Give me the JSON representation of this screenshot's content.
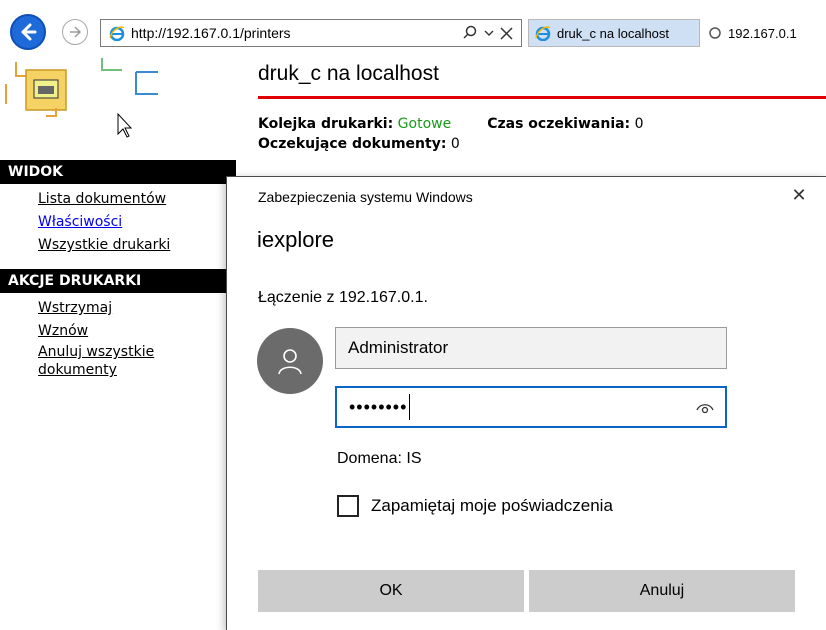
{
  "browser": {
    "url": "http://192.167.0.1/printers",
    "tabs": [
      {
        "label": "druk_c na localhost",
        "active": true
      },
      {
        "label": "192.167.0.1",
        "active": false
      }
    ]
  },
  "page": {
    "title": "druk_c na localhost",
    "queue_label": "Kolejka drukarki:",
    "queue_value": "Gotowe",
    "wait_label": "Czas oczekiwania:",
    "wait_value": "0",
    "pending_label": "Oczekujące dokumenty:",
    "pending_value": "0"
  },
  "sidebar": {
    "view_header": "WIDOK",
    "view_items": [
      {
        "label": "Lista dokumentów",
        "visited": false
      },
      {
        "label": "Właściwości",
        "visited": true
      },
      {
        "label": "Wszystkie drukarki",
        "visited": false
      }
    ],
    "actions_header": "AKCJE DRUKARKI",
    "action_items": [
      {
        "label": "Wstrzymaj"
      },
      {
        "label": "Wznów"
      },
      {
        "label": "Anuluj wszystkie dokumenty"
      }
    ]
  },
  "dialog": {
    "caption": "Zabezpieczenia systemu Windows",
    "close_glyph": "✕",
    "app_name": "iexplore",
    "connecting_text": "Łączenie z 192.167.0.1.",
    "username": "Administrator",
    "password_mask": "••••••••",
    "domain_text": "Domena: IS",
    "remember_label": "Zapamiętaj moje poświadczenia",
    "ok_label": "OK",
    "cancel_label": "Anuluj"
  },
  "colors": {
    "accent": "#0a64cc",
    "status_ok": "#1a9a1a",
    "title_rule": "#e00000"
  }
}
